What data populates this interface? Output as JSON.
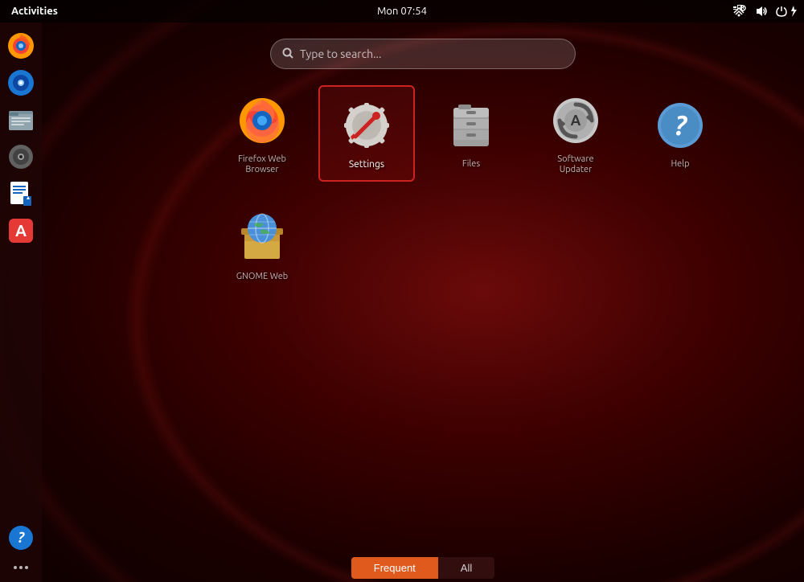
{
  "topbar": {
    "activities_label": "Activities",
    "clock": "Mon 07:54"
  },
  "search": {
    "placeholder": "Type to search..."
  },
  "apps_row1": [
    {
      "id": "firefox",
      "label": "Firefox Web Browser",
      "selected": false
    },
    {
      "id": "settings",
      "label": "Settings",
      "selected": true
    },
    {
      "id": "files",
      "label": "Files",
      "selected": false
    },
    {
      "id": "software-updater",
      "label": "Software Updater",
      "selected": false
    },
    {
      "id": "help",
      "label": "Help",
      "selected": false
    }
  ],
  "apps_row2": [
    {
      "id": "globe",
      "label": "GNOME Web",
      "selected": false
    }
  ],
  "tabs": [
    {
      "id": "frequent",
      "label": "Frequent",
      "active": true
    },
    {
      "id": "all",
      "label": "All",
      "active": false
    }
  ],
  "sidebar_items": [
    {
      "id": "firefox",
      "label": "Firefox"
    },
    {
      "id": "rhythmbox",
      "label": "Rhythmbox"
    },
    {
      "id": "files",
      "label": "Files"
    },
    {
      "id": "disk",
      "label": "Disk"
    },
    {
      "id": "writer",
      "label": "Writer"
    },
    {
      "id": "appstore",
      "label": "App Store"
    },
    {
      "id": "help",
      "label": "Help"
    }
  ]
}
